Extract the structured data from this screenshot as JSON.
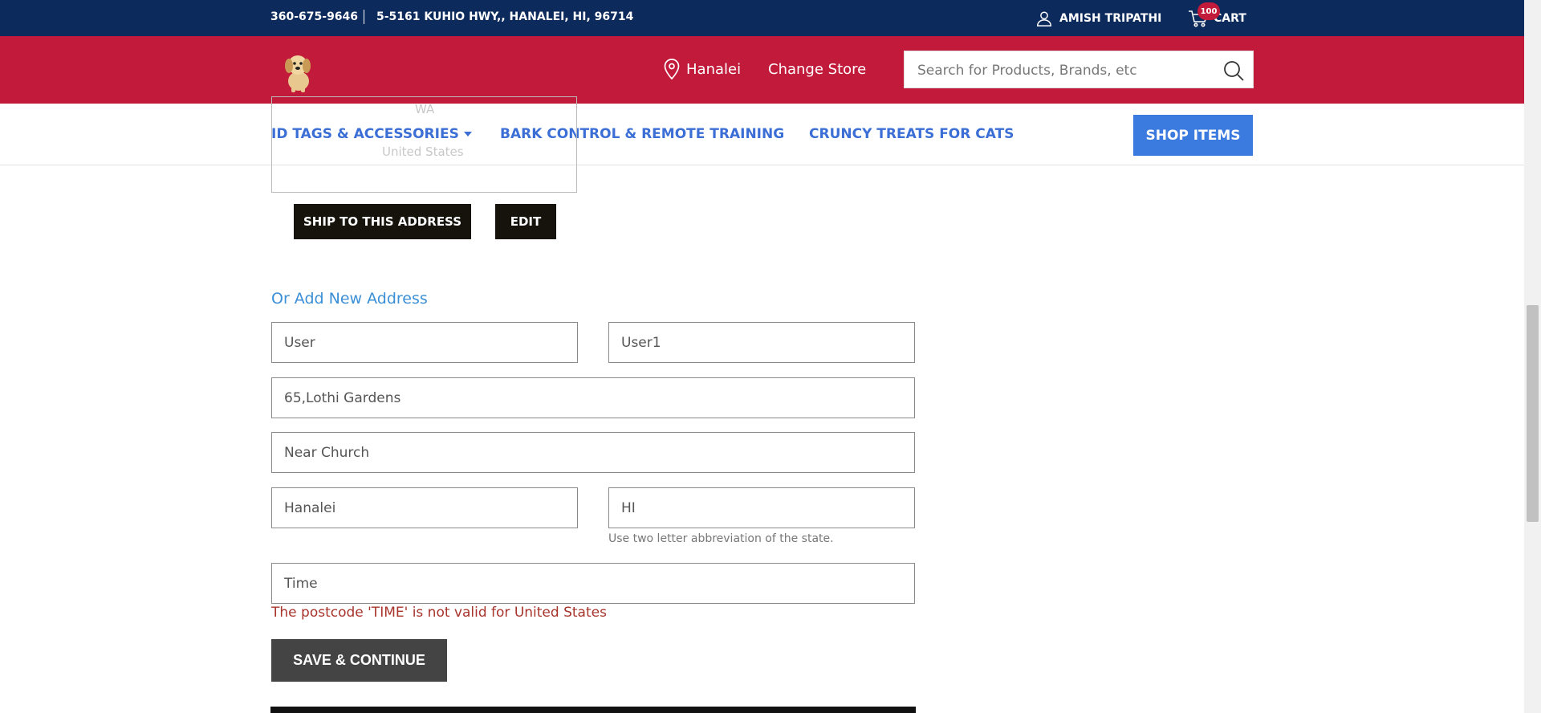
{
  "topbar": {
    "phone": "360-675-9646",
    "address": "5-5161 KUHIO HWY,, HANALEI, HI, 96714",
    "user_name": "AMISH TRIPATHI",
    "cart_count": "100",
    "cart_label": "CART"
  },
  "header": {
    "location": "Hanalei",
    "change_store": "Change Store",
    "search_placeholder": "Search for Products, Brands, etc"
  },
  "nav": {
    "items": [
      "ID TAGS & ACCESSORIES",
      "BARK CONTROL & REMOTE TRAINING",
      "CRUNCY TREATS FOR CATS"
    ],
    "shop_items": "SHOP ITEMS"
  },
  "saved_address": {
    "state": "WA",
    "country": "United States",
    "ship_label": "SHIP TO THIS ADDRESS",
    "edit_label": "EDIT"
  },
  "form": {
    "title": "Or Add New Address",
    "first_name": "User",
    "last_name": "User1",
    "address1": "65,Lothi Gardens",
    "address2": "Near Church",
    "city": "Hanalei",
    "state": "HI",
    "state_hint": "Use two letter abbreviation of the state.",
    "postcode": "Time",
    "error": "The postcode 'TIME' is not valid for United States",
    "save_label": "SAVE & CONTINUE"
  },
  "colors": {
    "topbar": "#0d2a5c",
    "brand_red": "#c21a3a",
    "nav_link": "#3b6fd6",
    "shop_button": "#3b7be0",
    "error": "#a8342c"
  }
}
